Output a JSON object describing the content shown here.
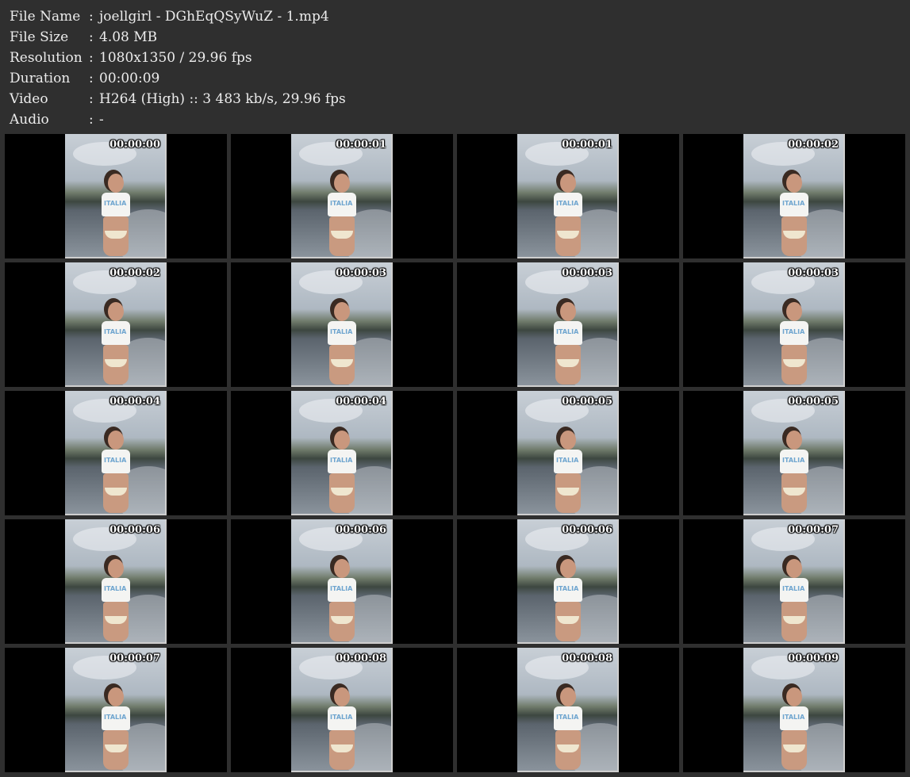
{
  "metadata": [
    {
      "label": "File Name",
      "value": "joellgirl - DGhEqQSyWuZ - 1.mp4"
    },
    {
      "label": "File Size",
      "value": "4.08 MB"
    },
    {
      "label": "Resolution",
      "value": "1080x1350 / 29.96 fps"
    },
    {
      "label": "Duration",
      "value": "00:00:09"
    },
    {
      "label": "Video",
      "value": "H264 (High) :: 3 483 kb/s, 29.96 fps"
    },
    {
      "label": "Audio",
      "value": "-"
    }
  ],
  "separator": ":",
  "thumb_label": "ITALIA",
  "thumbnails": [
    "00:00:00",
    "00:00:01",
    "00:00:01",
    "00:00:02",
    "00:00:02",
    "00:00:03",
    "00:00:03",
    "00:00:03",
    "00:00:04",
    "00:00:04",
    "00:00:05",
    "00:00:05",
    "00:00:06",
    "00:00:06",
    "00:00:06",
    "00:00:07",
    "00:00:07",
    "00:00:08",
    "00:00:08",
    "00:00:09"
  ]
}
